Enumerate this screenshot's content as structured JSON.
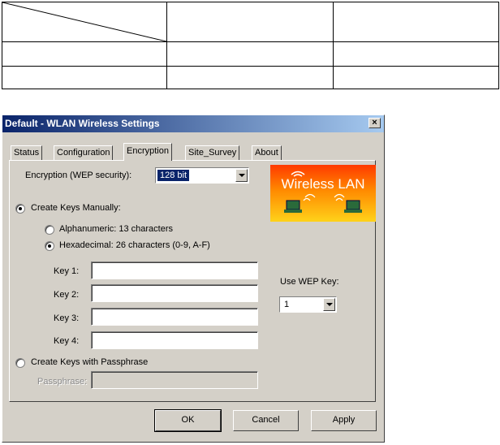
{
  "dialog": {
    "title": "Default - WLAN Wireless Settings",
    "close_glyph": "×",
    "tabs": [
      {
        "label": "Status"
      },
      {
        "label": "Configuration"
      },
      {
        "label": "Encryption"
      },
      {
        "label": "Site_Survey"
      },
      {
        "label": "About"
      }
    ],
    "active_tab": "Encryption"
  },
  "encryption": {
    "wep_label": "Encryption (WEP security):",
    "wep_value": "128 bit",
    "create_manual_label": "Create Keys Manually:",
    "create_manual_checked": true,
    "alphanumeric_label": "Alphanumeric: 13 characters",
    "alphanumeric_checked": false,
    "hex_label": "Hexadecimal: 26 characters (0-9, A-F)",
    "hex_checked": true,
    "keys": [
      {
        "label": "Key 1:",
        "value": ""
      },
      {
        "label": "Key 2:",
        "value": ""
      },
      {
        "label": "Key 3:",
        "value": ""
      },
      {
        "label": "Key 4:",
        "value": ""
      }
    ],
    "use_wep_key_label": "Use WEP Key:",
    "use_wep_key_value": "1",
    "passphrase_option_label": "Create Keys with Passphrase",
    "passphrase_option_checked": false,
    "passphrase_label": "Passphrase:",
    "passphrase_value": ""
  },
  "logo": {
    "text": "Wireless LAN",
    "colors": {
      "top": "#ff3a00",
      "bottom": "#ffd21a"
    }
  },
  "buttons": {
    "ok": "OK",
    "cancel": "Cancel",
    "apply": "Apply"
  },
  "colors": {
    "dialog_face": "#d4d0c8",
    "titlebar_start": "#0a246a",
    "titlebar_end": "#a6caf0",
    "selection": "#0a246a"
  }
}
